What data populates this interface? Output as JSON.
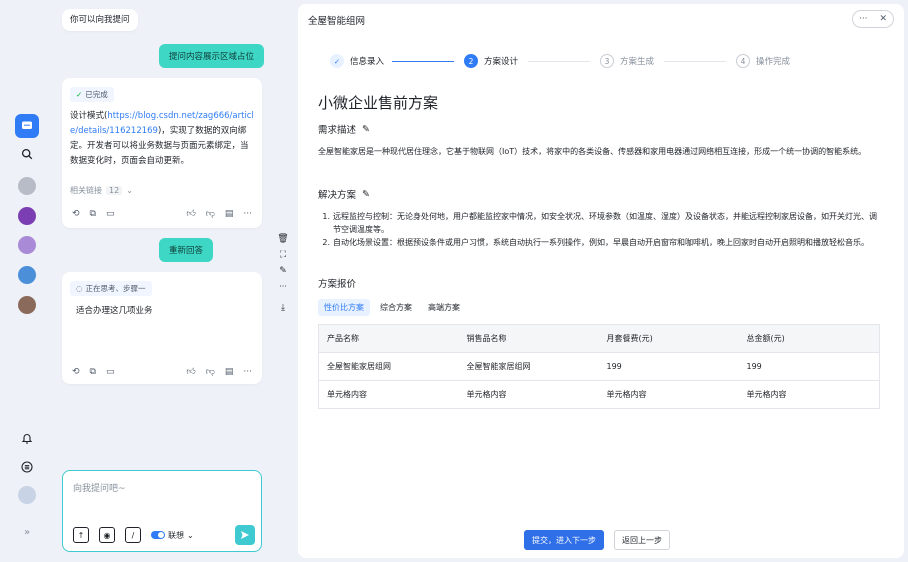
{
  "colors": {
    "accent": "#2f7cf6",
    "teal": "#3ed6c4",
    "bg": "#eef1f8"
  },
  "chat": {
    "prompt_hint": "你可以向我提问",
    "user_msg_1": "提问内容展示区域占位",
    "ai_msg_1": {
      "status": "已完成",
      "text_before_link": "设计模式(",
      "link": "https://blog.csdn.net/zag666/article/details/116212169",
      "text_after_link": ")，实现了数据的双向绑定。开发者可以将业务数据与页面元素绑定，当数据变化时，页面会自动更新。",
      "related_label": "相关链接",
      "related_count": "12"
    },
    "user_msg_2": "重新回答",
    "ai_msg_2": {
      "status": "正在思考、步骤一",
      "text": "适合办理这几项业务"
    },
    "input_placeholder": "向我提问吧~",
    "toggle_label": "联想"
  },
  "panel": {
    "title": "全屋智能组网",
    "steps": [
      {
        "num": "✓",
        "label": "信息录入",
        "state": "done"
      },
      {
        "num": "2",
        "label": "方案设计",
        "state": "active"
      },
      {
        "num": "3",
        "label": "方案生成",
        "state": "pending"
      },
      {
        "num": "4",
        "label": "操作完成",
        "state": "pending"
      }
    ],
    "doc_title": "小微企业售前方案",
    "req_heading": "需求描述",
    "req_text": "全屋智能家居是一种现代居住理念，它基于物联网（IoT）技术，将家中的各类设备、传感器和家用电器通过网络相互连接，形成一个统一协调的智能系统。",
    "sol_heading": "解决方案",
    "sol_items": [
      {
        "n": "1.",
        "text": "远程监控与控制：无论身处何地，用户都能监控家中情况，如安全状况、环境参数（如温度、湿度）及设备状态，并能远程控制家居设备，如开关灯光、调节空调温度等。"
      },
      {
        "n": "2.",
        "text": "自动化场景设置：根据预设条件或用户习惯，系统自动执行一系列操作，例如，早晨自动开启窗帘和咖啡机，晚上回家时自动开启照明和播放轻松音乐。"
      }
    ],
    "quote_heading": "方案报价",
    "tabs": [
      "性价比方案",
      "综合方案",
      "高端方案"
    ],
    "table": {
      "headers": [
        "产品名称",
        "销售品名称",
        "月套餐费(元)",
        "总金额(元)"
      ],
      "rows": [
        [
          "全屋智能家居组网",
          "全屋智能家居组网",
          "199",
          "199"
        ],
        [
          "单元格内容",
          "单元格内容",
          "单元格内容",
          "单元格内容"
        ]
      ]
    },
    "submit_label": "提交，进入下一步",
    "back_label": "返回上一步"
  }
}
